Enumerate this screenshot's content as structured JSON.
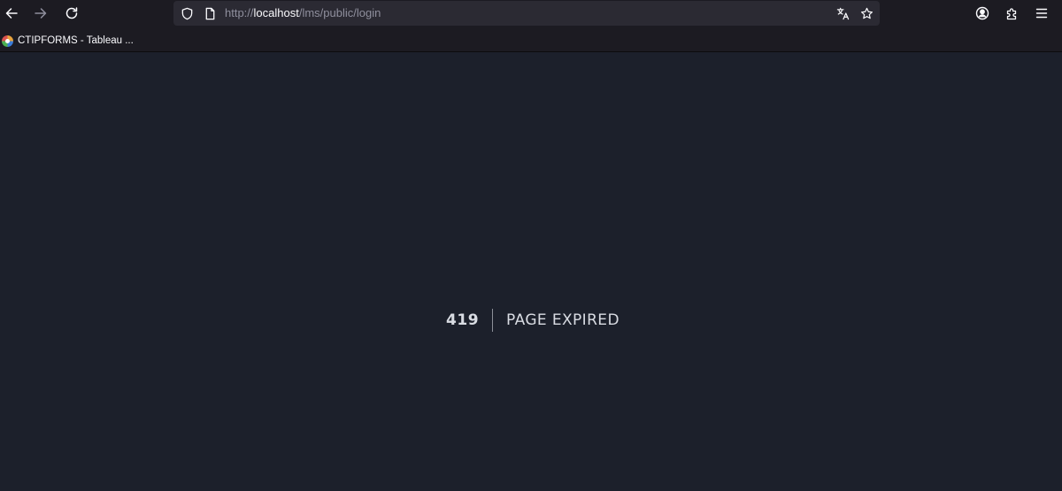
{
  "browser": {
    "url": {
      "prefix": "http://",
      "host": "localhost",
      "path": "/lms/public/login"
    },
    "icons": {
      "back": "arrow-left-icon",
      "forward": "arrow-right-icon",
      "reload": "reload-icon",
      "site_info": "shield-icon",
      "page": "page-icon",
      "translate": "translate-icon",
      "bookmark": "star-icon",
      "account": "account-icon",
      "extensions": "puzzle-icon",
      "menu": "hamburger-menu-icon"
    }
  },
  "bookmarks_bar": {
    "items": [
      {
        "label": "CTIPFORMS - Tableau ..."
      }
    ]
  },
  "page": {
    "error_code": "419",
    "error_message": "PAGE EXPIRED"
  },
  "colors": {
    "page_background": "#1c202b",
    "toolbar_background": "#1c1b22",
    "urlbar_background": "#2b2a33",
    "text": "#d9dce3"
  }
}
